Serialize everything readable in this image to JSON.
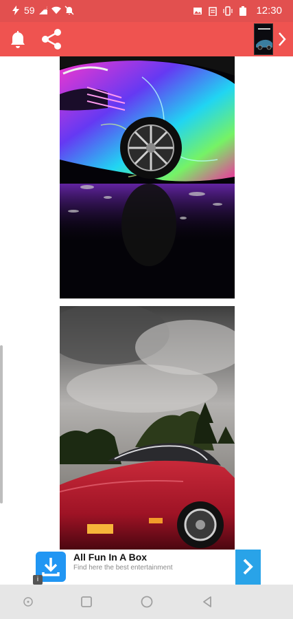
{
  "status_bar": {
    "battery_label": "59",
    "time": "12:30",
    "icons": [
      "charging-bolt-icon",
      "signal-off-icon",
      "wifi-icon",
      "notifications-muted-icon",
      "image-icon",
      "clipboard-icon",
      "vibrate-icon",
      "battery-icon"
    ]
  },
  "toolbar": {
    "icons": [
      "bell-icon",
      "share-icon",
      "next-chevron-icon"
    ],
    "color": "#ef5350"
  },
  "ad": {
    "title": "All Fun In A Box",
    "subtitle": "Find here the best entertainment",
    "info_label": "i",
    "accent": "#29a3e8"
  },
  "nav_bar": {
    "icons": [
      "assistant-dot-icon",
      "recents-square-icon",
      "home-circle-icon",
      "back-triangle-icon"
    ]
  },
  "colors": {
    "status_bar": "#e2504f",
    "toolbar": "#ef5350"
  }
}
